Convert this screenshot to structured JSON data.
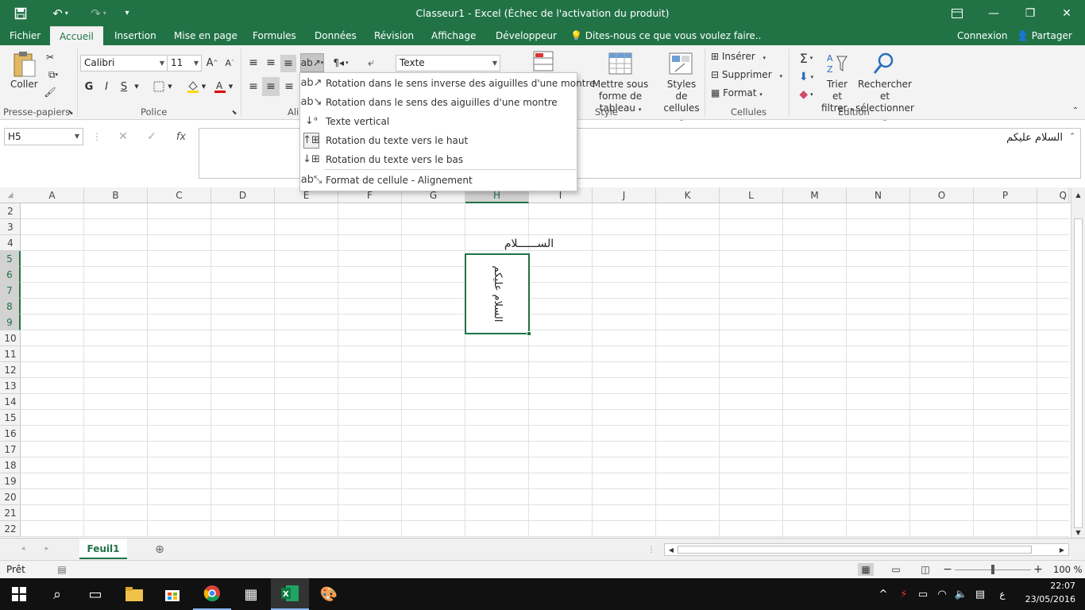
{
  "titlebar": {
    "title": "Classeur1 - Excel (Échec de l'activation du produit)",
    "save_icon": "save-icon",
    "undo_icon": "undo-icon",
    "redo_icon": "redo-icon",
    "customize_icon": "customize-icon",
    "window_icons": [
      "ribbon-display-icon",
      "minimize-icon",
      "restore-icon",
      "close-icon"
    ]
  },
  "tabs": {
    "items": [
      "Fichier",
      "Accueil",
      "Insertion",
      "Mise en page",
      "Formules",
      "Données",
      "Révision",
      "Affichage",
      "Développeur"
    ],
    "active": "Accueil",
    "tellme": "Dites-nous ce que vous voulez faire..",
    "connexion": "Connexion",
    "share": "Partager"
  },
  "ribbon": {
    "clipboard": {
      "label": "Presse-papiers",
      "paste": "Coller"
    },
    "font": {
      "label": "Police",
      "name": "Calibri",
      "size": "11",
      "bold": "G",
      "italic": "I",
      "underline": "S"
    },
    "alignment": {
      "label": "Ali"
    },
    "number": {
      "format": "Texte"
    },
    "styles": {
      "label": "Style",
      "table": "Mettre sous forme de tableau",
      "cell_styles": "Styles de cellules"
    },
    "cells": {
      "label": "Cellules",
      "insert": "Insérer",
      "delete": "Supprimer",
      "format": "Format"
    },
    "editing": {
      "label": "Édition",
      "sort": "Trier et filtrer",
      "find": "Rechercher et sélectionner"
    }
  },
  "formula_bar": {
    "name_box": "H5",
    "content": "السلام عليكم"
  },
  "grid": {
    "columns": [
      "A",
      "B",
      "C",
      "D",
      "E",
      "F",
      "G",
      "H",
      "I",
      "J",
      "K",
      "L",
      "M",
      "N",
      "O",
      "P",
      "Q"
    ],
    "rows": [
      "2",
      "3",
      "4",
      "5",
      "6",
      "7",
      "8",
      "9",
      "10",
      "11",
      "12",
      "13",
      "14",
      "15",
      "16",
      "17",
      "18",
      "19",
      "20",
      "21",
      "22"
    ],
    "selected_column": "H",
    "cell_h4": "الســــــلام",
    "cell_h5": "السلام عليكم"
  },
  "menu": {
    "items": [
      {
        "label": "Rotation dans le sens inverse des aiguilles d'une montre",
        "icon": "rotate-ccw-icon"
      },
      {
        "label": "Rotation dans le sens des aiguilles d'une montre",
        "icon": "rotate-cw-icon"
      },
      {
        "label": "Texte vertical",
        "icon": "vertical-text-icon"
      },
      {
        "label": "Rotation du texte vers le haut",
        "icon": "rotate-up-icon"
      },
      {
        "label": "Rotation du texte vers le bas",
        "icon": "rotate-down-icon"
      },
      {
        "label": "Format de cellule - Alignement",
        "icon": "format-alignment-icon"
      }
    ]
  },
  "sheets": {
    "tabs": [
      "Feuil1"
    ],
    "active": "Feuil1"
  },
  "status": {
    "ready": "Prêt",
    "zoom": "100 %"
  },
  "taskbar": {
    "time": "22:07",
    "date": "23/05/2016",
    "lang": "ع"
  }
}
